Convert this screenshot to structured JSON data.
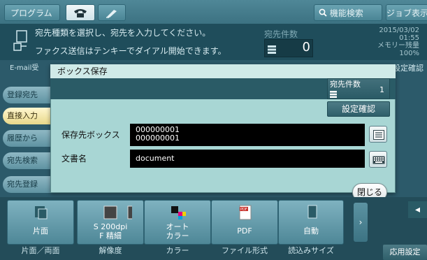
{
  "topbar": {
    "program": "プログラム",
    "search": "機能検索",
    "job": "ジョブ表示"
  },
  "message": {
    "line1": "宛先種類を選択し、宛先を入力してください。",
    "line2": "ファクス送信はテンキーでダイアル開始できます。",
    "count_label": "宛先件数",
    "count_value": "0",
    "date": "2015/03/02",
    "time": "01:55",
    "memory_label": "メモリー残量",
    "memory_value": "100%"
  },
  "background": {
    "email_tab": "E-mail受",
    "confirm": "設定確認",
    "left_tabs": [
      "登録宛先",
      "直接入力",
      "履歴から",
      "宛先検索",
      "宛先登録"
    ]
  },
  "dialog": {
    "title": "ボックス保存",
    "count_label": "宛先件数",
    "count_value": "1",
    "confirm": "設定確認",
    "box_label": "保存先ボックス",
    "box_value1": "000000001",
    "box_value2": "000000001",
    "doc_label": "文書名",
    "doc_value": "document",
    "close": "閉じる"
  },
  "bottom": {
    "tiles": [
      {
        "text1": "片面",
        "text2": "",
        "text3": "",
        "caption": "片面／両面"
      },
      {
        "text1": "S 200dpi",
        "text2": "F 精細",
        "text3": "",
        "caption": "解像度"
      },
      {
        "text1": "オート",
        "text2": "カラー",
        "text3": "",
        "caption": "カラー"
      },
      {
        "text1": "PDF",
        "text2": "",
        "text3": "",
        "caption": "ファイル形式"
      },
      {
        "text1": "自動",
        "text2": "",
        "text3": "",
        "caption": "読込みサイズ"
      }
    ],
    "apply": "応用設定",
    "pdf_icon": "PDF"
  },
  "colors": {
    "background": "#2c5a6a",
    "dialog": "#a8d6d4",
    "field": "#000000"
  }
}
